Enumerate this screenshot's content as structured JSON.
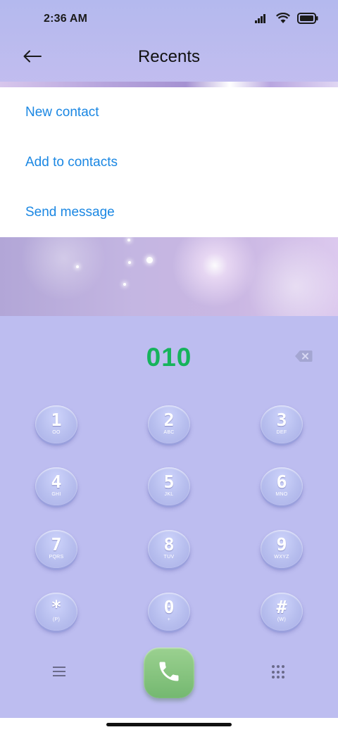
{
  "status_bar": {
    "time": "2:36 AM",
    "icons": [
      "signal-icon",
      "wifi-icon",
      "battery-icon"
    ]
  },
  "header": {
    "title": "Recents",
    "back_icon": "back-arrow-icon"
  },
  "menu": {
    "items": [
      {
        "label": "New contact"
      },
      {
        "label": "Add to contacts"
      },
      {
        "label": "Send message"
      }
    ]
  },
  "dialer": {
    "number": "010",
    "keys": [
      {
        "digit": "1",
        "letters": "OO"
      },
      {
        "digit": "2",
        "letters": "ABC"
      },
      {
        "digit": "3",
        "letters": "DEF"
      },
      {
        "digit": "4",
        "letters": "GHI"
      },
      {
        "digit": "5",
        "letters": "JKL"
      },
      {
        "digit": "6",
        "letters": "MNO"
      },
      {
        "digit": "7",
        "letters": "PQRS"
      },
      {
        "digit": "8",
        "letters": "TUV"
      },
      {
        "digit": "9",
        "letters": "WXYZ"
      },
      {
        "digit": "*",
        "letters": "(P)"
      },
      {
        "digit": "0",
        "letters": "+"
      },
      {
        "digit": "#",
        "letters": "(W)"
      }
    ]
  },
  "colors": {
    "accent_blue": "#1a87e3",
    "number_green": "#16b35c",
    "call_green": "#86c47c",
    "dialer_bg": "#bdbdf0"
  }
}
